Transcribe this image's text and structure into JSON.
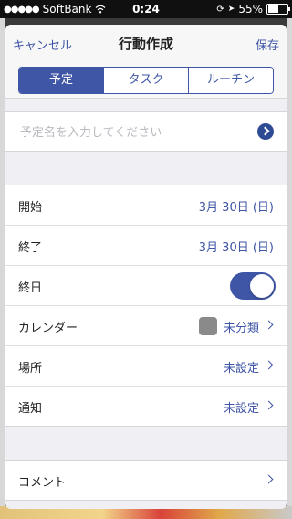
{
  "status_bar": {
    "carrier": "SoftBank",
    "time": "0:24",
    "battery_percent": "55%",
    "battery_level": 0.55
  },
  "nav": {
    "cancel_label": "キャンセル",
    "title": "行動作成",
    "save_label": "保存"
  },
  "tabs": [
    {
      "label": "予定",
      "active": true
    },
    {
      "label": "タスク",
      "active": false
    },
    {
      "label": "ルーチン",
      "active": false
    }
  ],
  "name_input": {
    "placeholder": "予定名を入力してください",
    "value": ""
  },
  "rows": {
    "start": {
      "label": "開始",
      "value": "3月 30日 (日)"
    },
    "end": {
      "label": "終了",
      "value": "3月 30日 (日)"
    },
    "all_day": {
      "label": "終日",
      "on": true
    },
    "calendar": {
      "label": "カレンダー",
      "value": "未分類",
      "swatch_color": "#8a8a8a"
    },
    "place": {
      "label": "場所",
      "value": "未設定"
    },
    "notify": {
      "label": "通知",
      "value": "未設定"
    }
  },
  "comment": {
    "label": "コメント"
  },
  "colors": {
    "accent": "#3f55a6"
  }
}
